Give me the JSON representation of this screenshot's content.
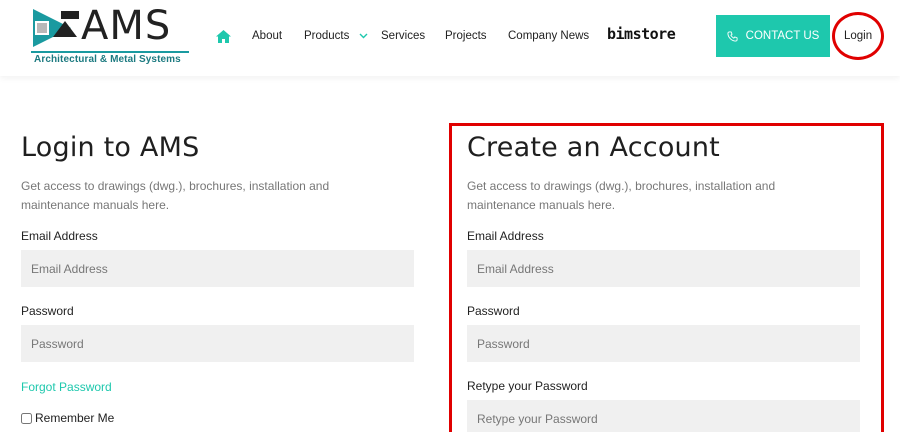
{
  "brand": {
    "name": "AMS",
    "tagline": "Architectural & Metal Systems",
    "accent": "#1ec8ad",
    "teal_dark": "#1a9aa0"
  },
  "nav": {
    "home_icon": "home-icon",
    "items": [
      "About",
      "Products",
      "Services",
      "Projects",
      "Company News"
    ],
    "bimstore": "bimstore",
    "contact": "CONTACT US",
    "contact_icon": "phone-icon",
    "login": "Login"
  },
  "login_form": {
    "title": "Login to AMS",
    "description": "Get access to drawings (dwg.), brochures, installation and maintenance manuals here.",
    "email_label": "Email Address",
    "email_placeholder": "Email Address",
    "password_label": "Password",
    "password_placeholder": "Password",
    "forgot": "Forgot Password",
    "remember": "Remember Me"
  },
  "register_form": {
    "title": "Create an Account",
    "description": "Get access to drawings (dwg.), brochures, installation and maintenance manuals here.",
    "email_label": "Email Address",
    "email_placeholder": "Email Address",
    "password_label": "Password",
    "password_placeholder": "Password",
    "retype_label": "Retype your Password",
    "retype_placeholder": "Retype your Password"
  },
  "annotation_color": "#e00000"
}
